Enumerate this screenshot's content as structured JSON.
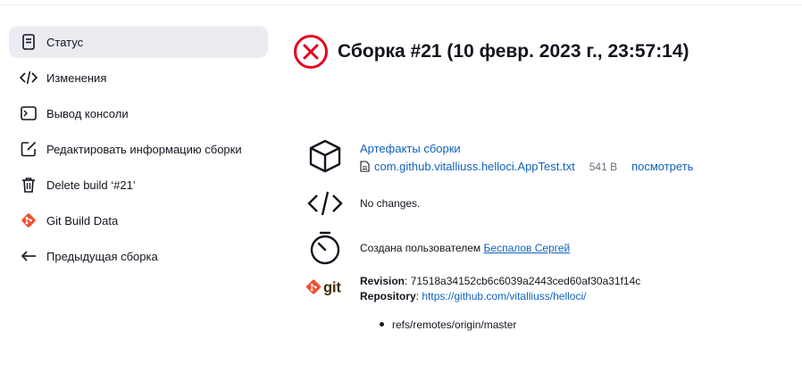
{
  "sidebar": {
    "items": [
      {
        "label": "Статус",
        "icon": "document-icon",
        "active": true
      },
      {
        "label": "Изменения",
        "icon": "code-icon"
      },
      {
        "label": "Вывод консоли",
        "icon": "terminal-icon"
      },
      {
        "label": "Редактировать информацию сборки",
        "icon": "edit-icon"
      },
      {
        "label": "Delete build ‘#21’",
        "icon": "trash-icon"
      },
      {
        "label": "Git Build Data",
        "icon": "git-icon"
      },
      {
        "label": "Предыдущая сборка",
        "icon": "arrow-left-icon"
      }
    ]
  },
  "build": {
    "title": "Сборка #21 (10 февр. 2023 г., 23:57:14)",
    "status_icon": "failed-x-icon",
    "status_color": "#e6001f"
  },
  "artifacts": {
    "heading": "Артефакты сборки",
    "file_name": "com.github.vitalliuss.helloci.AppTest.txt",
    "file_size": "541 B",
    "view_label": "посмотреть"
  },
  "changes": {
    "text": "No changes."
  },
  "started_by": {
    "prefix": "Создана пользователем",
    "user": "Беспалов Сергей"
  },
  "git": {
    "revision_label": "Revision",
    "revision": "71518a34152cb6c6039a2443ced60af30a31f14c",
    "repository_label": "Repository",
    "repository_url": "https://github.com/vitalliuss/helloci/",
    "refs": [
      "refs/remotes/origin/master"
    ]
  },
  "colors": {
    "link": "#1062be",
    "accent_red": "#e6001f",
    "git_orange": "#f05133"
  }
}
